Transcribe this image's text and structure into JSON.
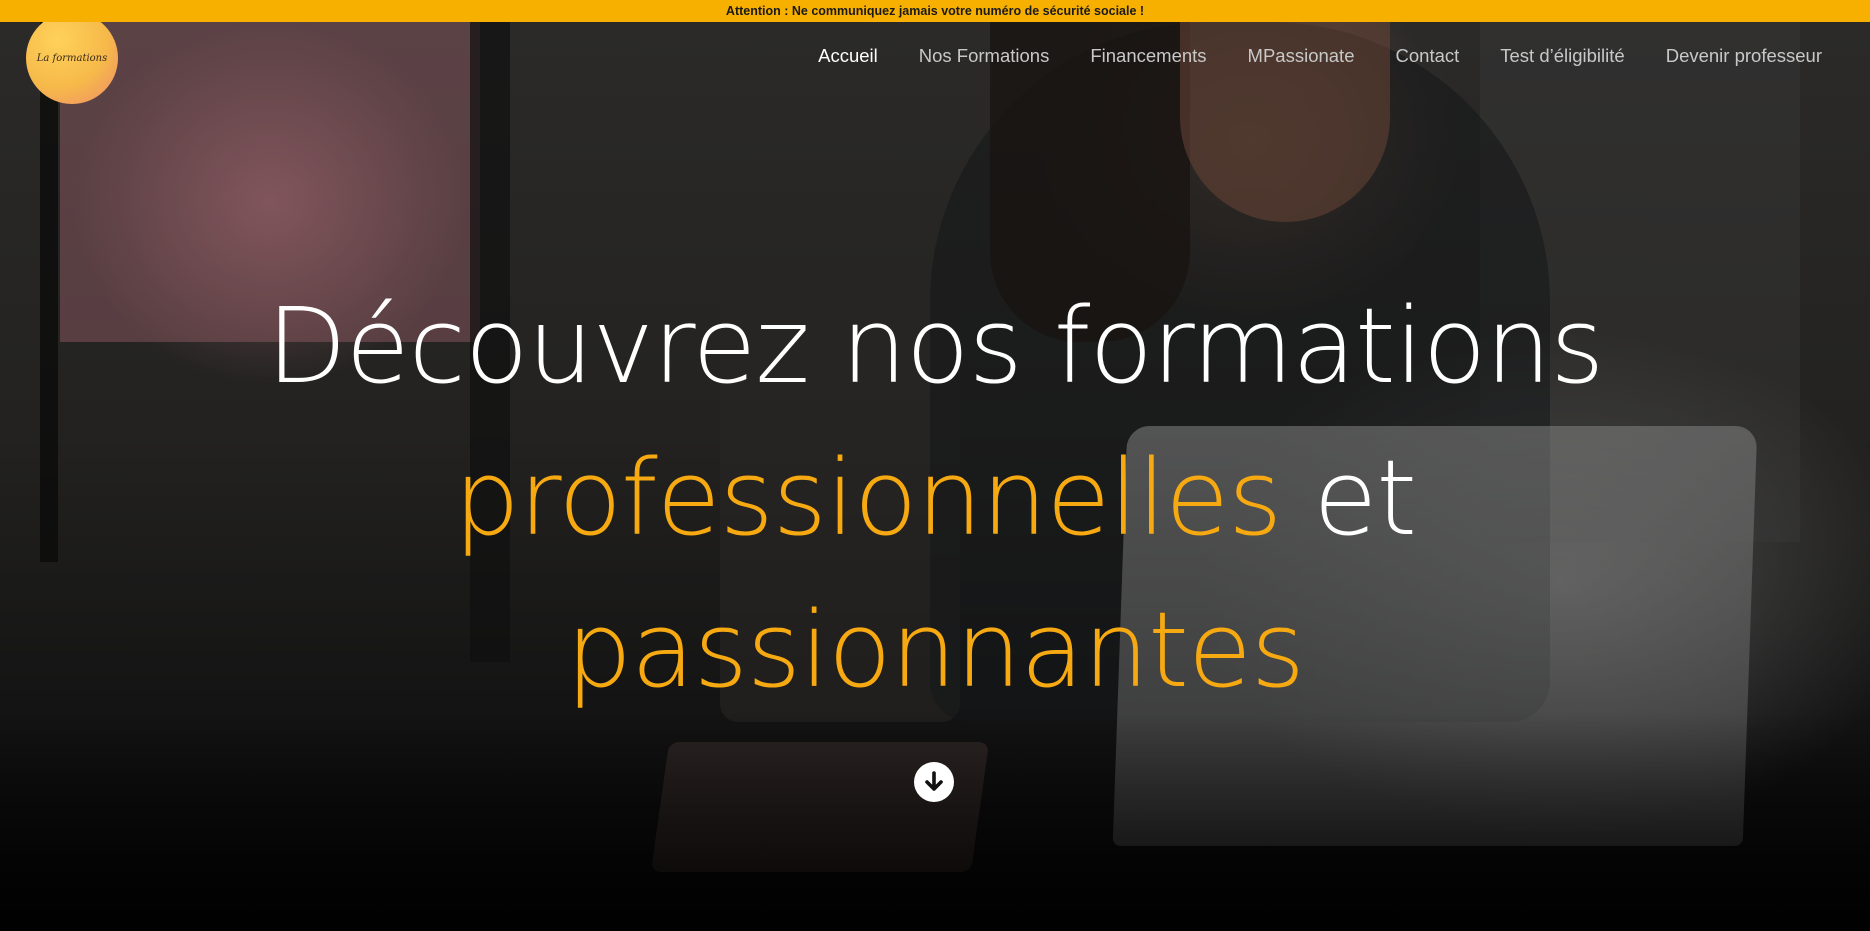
{
  "alert": {
    "text": "Attention : Ne communiquez jamais votre numéro de sécurité sociale !",
    "background": "#f8b000"
  },
  "logo": {
    "text": "La formations"
  },
  "nav": {
    "items": [
      {
        "label": "Accueil",
        "active": true
      },
      {
        "label": "Nos Formations",
        "active": false
      },
      {
        "label": "Financements",
        "active": false
      },
      {
        "label": "MPassionate",
        "active": false
      },
      {
        "label": "Contact",
        "active": false
      },
      {
        "label": "Test d’éligibilité",
        "active": false
      },
      {
        "label": "Devenir professeur",
        "active": false
      }
    ]
  },
  "hero": {
    "line1": "Découvrez nos formations",
    "line2_highlight": "professionnelles",
    "line2_rest": " et",
    "line3_highlight": "passionnantes",
    "accent_color": "#f7a912",
    "scroll_icon": "arrow-down-circle-icon"
  }
}
